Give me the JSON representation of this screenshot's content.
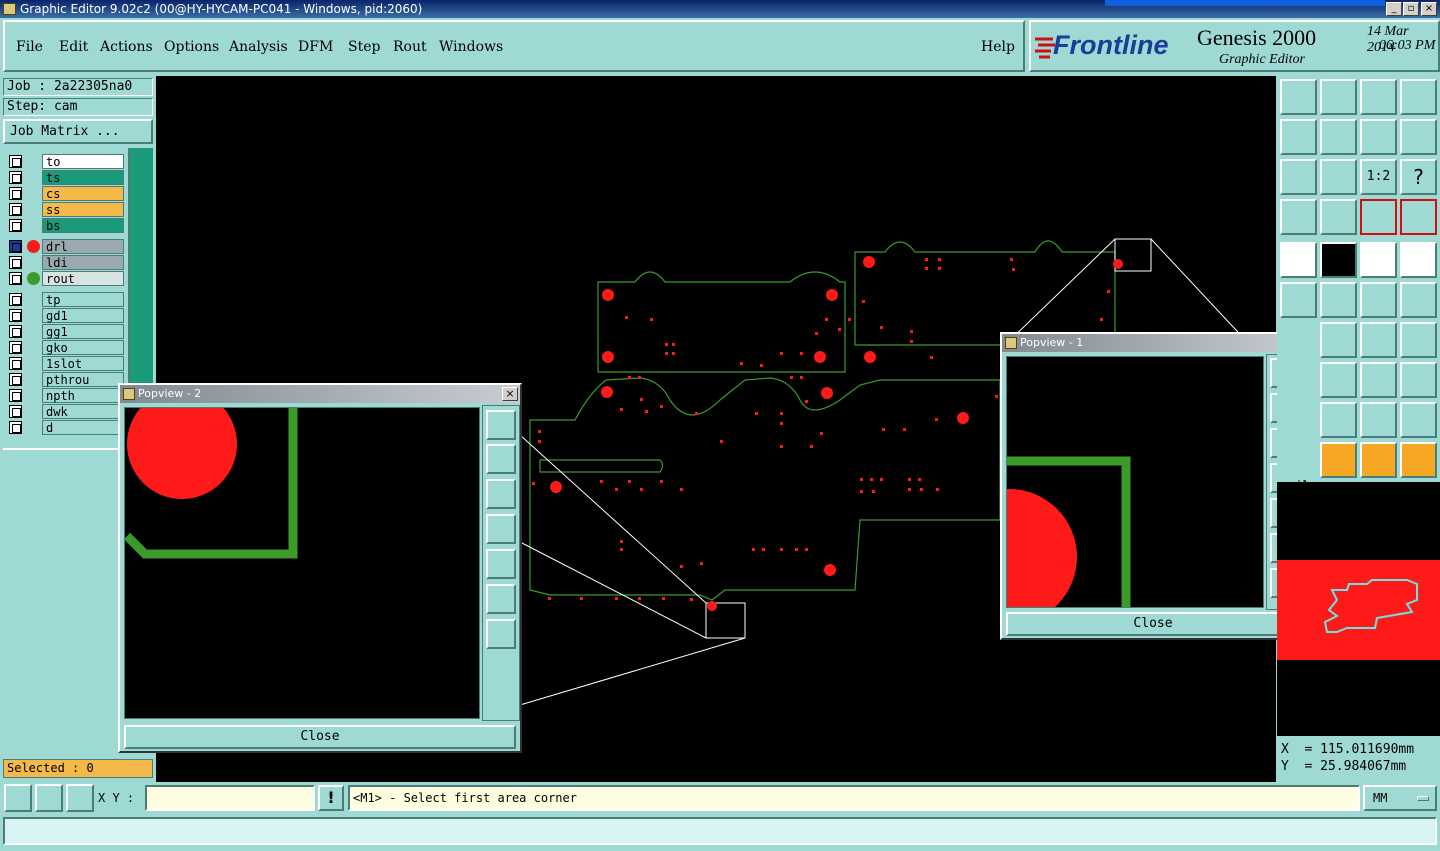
{
  "window": {
    "title": "Graphic Editor 9.02c2 (00@HY-HYCAM-PC041 - Windows, pid:2060)"
  },
  "menu": {
    "file": "File",
    "edit": "Edit",
    "actions": "Actions",
    "options": "Options",
    "analysis": "Analysis",
    "dfm": "DFM",
    "step": "Step",
    "rout": "Rout",
    "windows": "Windows",
    "help": "Help"
  },
  "brand": {
    "logo": "Frontline",
    "product": "Genesis 2000",
    "subtitle": "Graphic Editor",
    "date": "14 Mar 2014",
    "time": "06:03 PM"
  },
  "job": {
    "job_label": "Job : 2a22305na0",
    "step_label": "Step: cam",
    "matrix_button": "Job Matrix ..."
  },
  "layers": [
    {
      "name": "to",
      "color": "#ffffff"
    },
    {
      "name": "ts",
      "color": "#1a9a78"
    },
    {
      "name": "cs",
      "color": "#f5b94a"
    },
    {
      "name": "ss",
      "color": "#f5b94a"
    },
    {
      "name": "bs",
      "color": "#1a9a78"
    },
    {
      "name": "drl",
      "color": "#9aa8b0"
    },
    {
      "name": "ldi",
      "color": "#9aa8b0"
    },
    {
      "name": "rout",
      "color": "#d8e4e4"
    },
    {
      "name": "tp",
      "color": "#9fd9d3"
    },
    {
      "name": "gd1",
      "color": "#9fd9d3"
    },
    {
      "name": "gg1",
      "color": "#9fd9d3"
    },
    {
      "name": "gko",
      "color": "#9fd9d3"
    },
    {
      "name": "1slot",
      "color": "#9fd9d3"
    },
    {
      "name": "pthrou",
      "color": "#9fd9d3"
    },
    {
      "name": "npth",
      "color": "#9fd9d3"
    },
    {
      "name": "dwk",
      "color": "#9fd9d3"
    },
    {
      "name": "d",
      "color": "#9fd9d3"
    }
  ],
  "selected": "Selected : 0",
  "popview2": {
    "title": "Popview - 2",
    "close": "Close"
  },
  "popview1": {
    "title": "Popview - 1",
    "close": "Close"
  },
  "coords": {
    "x": "X  = 115.011690mm",
    "y": "Y  = 25.984067mm"
  },
  "status": {
    "xy_label": "X Y :",
    "xy_value": "",
    "message": "<M1> - Select first area corner",
    "units": "MM"
  },
  "colors": {
    "board_outline": "#3c9a2a",
    "pad": "#ff1a1a",
    "background": "#9fd9d3",
    "canvas": "#000000"
  }
}
